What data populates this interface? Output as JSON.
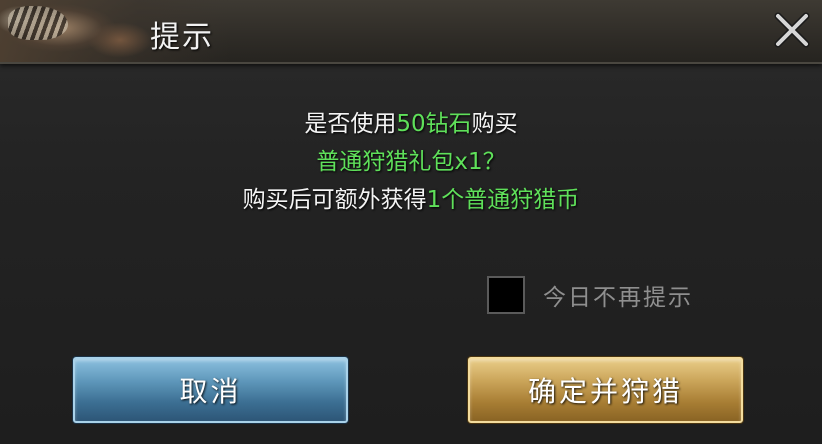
{
  "dialog": {
    "title": "提示",
    "close_icon": "close-icon"
  },
  "message": {
    "line1_prefix": "是否使用",
    "line1_highlight": "50钻石",
    "line1_suffix": "购买",
    "line2_highlight": "普通狩猎礼包x1？",
    "line3_prefix": "购买后可额外获得",
    "line3_highlight": "1个普通狩猎币"
  },
  "checkbox": {
    "label": "今日不再提示",
    "checked": false
  },
  "buttons": {
    "cancel_label": "取消",
    "confirm_label": "确定并狩猎"
  },
  "colors": {
    "highlight_green": "#5fe05a",
    "cancel_blue": "#5f98bb",
    "confirm_gold": "#cba55a"
  }
}
